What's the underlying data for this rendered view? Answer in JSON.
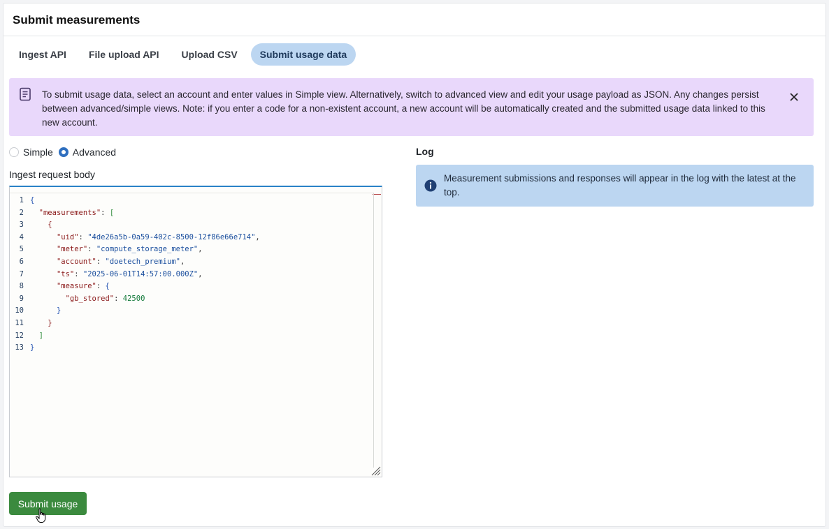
{
  "header": {
    "title": "Submit measurements"
  },
  "tabs": [
    {
      "label": "Ingest API",
      "active": false
    },
    {
      "label": "File upload API",
      "active": false
    },
    {
      "label": "Upload CSV",
      "active": false
    },
    {
      "label": "Submit usage data",
      "active": true
    }
  ],
  "banner": {
    "icon": "document-icon",
    "text": "To submit usage data, select an account and enter values in Simple view. Alternatively, switch to advanced view and edit your usage payload as JSON. Any changes persist between advanced/simple views. Note: if you enter a code for a non-existent account, a new account will be automatically created and the submitted usage data linked to this new account.",
    "close_icon": "close-icon",
    "color": "#e9d8fb"
  },
  "view_mode": {
    "options": [
      "Simple",
      "Advanced"
    ],
    "selected": "Advanced"
  },
  "editor": {
    "label": "Ingest request body",
    "lines": [
      {
        "n": "1",
        "parts": [
          [
            "b0",
            "{"
          ]
        ]
      },
      {
        "n": "2",
        "parts": [
          [
            "p",
            "  "
          ],
          [
            "k",
            "\"measurements\""
          ],
          [
            "p",
            ": "
          ],
          [
            "b1",
            "["
          ]
        ]
      },
      {
        "n": "3",
        "parts": [
          [
            "p",
            "    "
          ],
          [
            "b2",
            "{"
          ]
        ]
      },
      {
        "n": "4",
        "parts": [
          [
            "p",
            "      "
          ],
          [
            "k",
            "\"uid\""
          ],
          [
            "p",
            ": "
          ],
          [
            "s",
            "\"4de26a5b-0a59-402c-8500-12f86e66e714\""
          ],
          [
            "p",
            ","
          ]
        ]
      },
      {
        "n": "5",
        "parts": [
          [
            "p",
            "      "
          ],
          [
            "k",
            "\"meter\""
          ],
          [
            "p",
            ": "
          ],
          [
            "s",
            "\"compute_storage_meter\""
          ],
          [
            "p",
            ","
          ]
        ]
      },
      {
        "n": "6",
        "parts": [
          [
            "p",
            "      "
          ],
          [
            "k",
            "\"account\""
          ],
          [
            "p",
            ": "
          ],
          [
            "s",
            "\"doetech_premium\""
          ],
          [
            "p",
            ","
          ]
        ]
      },
      {
        "n": "7",
        "parts": [
          [
            "p",
            "      "
          ],
          [
            "k",
            "\"ts\""
          ],
          [
            "p",
            ": "
          ],
          [
            "s",
            "\"2025-06-01T14:57:00.000Z\""
          ],
          [
            "p",
            ","
          ]
        ]
      },
      {
        "n": "8",
        "parts": [
          [
            "p",
            "      "
          ],
          [
            "k",
            "\"measure\""
          ],
          [
            "p",
            ": "
          ],
          [
            "b0",
            "{"
          ]
        ]
      },
      {
        "n": "9",
        "parts": [
          [
            "p",
            "        "
          ],
          [
            "k",
            "\"gb_stored\""
          ],
          [
            "p",
            ": "
          ],
          [
            "n",
            "42500"
          ]
        ]
      },
      {
        "n": "10",
        "parts": [
          [
            "p",
            "      "
          ],
          [
            "b0",
            "}"
          ]
        ]
      },
      {
        "n": "11",
        "parts": [
          [
            "p",
            "    "
          ],
          [
            "b2",
            "}"
          ]
        ]
      },
      {
        "n": "12",
        "parts": [
          [
            "p",
            "  "
          ],
          [
            "b1",
            "]"
          ]
        ]
      },
      {
        "n": "13",
        "parts": [
          [
            "b0",
            "}"
          ]
        ]
      }
    ]
  },
  "submit": {
    "label": "Submit usage",
    "color": "#3b8a3e"
  },
  "log": {
    "title": "Log",
    "icon": "info-icon",
    "message": "Measurement submissions and responses will appear in the log with the latest at the top.",
    "color": "#bcd6f1"
  }
}
